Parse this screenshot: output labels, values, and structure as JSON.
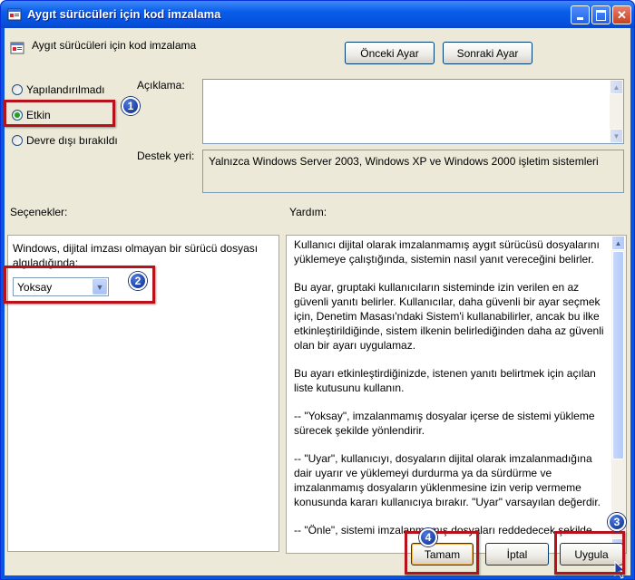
{
  "window": {
    "title": "Aygıt sürücüleri için kod imzalama"
  },
  "policy_title": "Aygıt sürücüleri için kod imzalama",
  "nav": {
    "prev": "Önceki Ayar",
    "next": "Sonraki Ayar"
  },
  "radios": [
    {
      "label": "Yapılandırılmadı",
      "selected": false
    },
    {
      "label": "Etkin",
      "selected": true
    },
    {
      "label": "Devre dışı bırakıldı",
      "selected": false
    }
  ],
  "labels": {
    "description": "Açıklama:",
    "supported": "Destek yeri:",
    "options": "Seçenekler:",
    "help": "Yardım:"
  },
  "description_text": "",
  "supported_text": "Yalnızca Windows Server 2003, Windows XP ve Windows 2000 işletim sistemleri",
  "options": {
    "prompt": "Windows, dijital imzası olmayan bir sürücü dosyası algıladığında:",
    "selected": "Yoksay"
  },
  "help_paragraphs": [
    "Kullanıcı dijital olarak imzalanmamış aygıt sürücüsü dosyalarını yüklemeye çalıştığında, sistemin nasıl yanıt vereceğini belirler.",
    "Bu ayar, gruptaki kullanıcıların sisteminde izin verilen en az güvenli yanıtı belirler. Kullanıcılar, daha güvenli bir ayar seçmek için, Denetim Masası'ndaki Sistem'i kullanabilirler, ancak bu ilke etkinleştirildiğinde, sistem ilkenin belirlediğinden daha az güvenli olan bir ayarı uygulamaz.",
    "Bu ayarı etkinleştirdiğinizde, istenen yanıtı belirtmek için açılan liste kutusunu kullanın.",
    "--   \"Yoksay\", imzalanmamış dosyalar içerse de sistemi yükleme sürecek şekilde yönlendirir.",
    "--   \"Uyar\", kullanıcıyı, dosyaların dijital olarak imzalanmadığına dair uyarır ve yüklemeyi durdurma ya da sürdürme ve imzalanmamış dosyaların yüklenmesine izin verip vermeme konusunda kararı kullanıcıya bırakır. \"Uyar\" varsayılan değerdir.",
    "--   \"Önle\", sistemi imzalanmamış dosyaları reddedecek şekilde"
  ],
  "buttons": {
    "ok": "Tamam",
    "cancel": "İptal",
    "apply": "Uygula"
  },
  "badges": [
    "1",
    "2",
    "3",
    "4"
  ]
}
